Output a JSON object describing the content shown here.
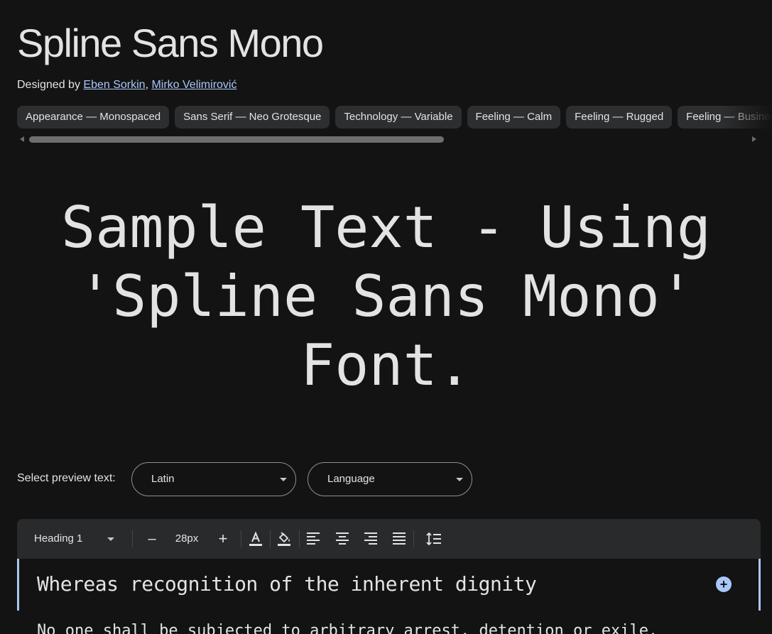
{
  "font": {
    "title": "Spline Sans Mono",
    "designed_by_prefix": "Designed by ",
    "designers": [
      "Eben Sorkin",
      "Mirko Velimirović"
    ],
    "designer_separator": ", "
  },
  "tags": [
    "Appearance — Monospaced",
    "Sans Serif — Neo Grotesque",
    "Technology — Variable",
    "Feeling — Calm",
    "Feeling — Rugged",
    "Feeling — Business"
  ],
  "sample_text": "Sample Text - Using 'Spline Sans Mono' Font.",
  "preview": {
    "label": "Select preview text:",
    "script_select": "Latin",
    "language_select": "Language"
  },
  "toolbar": {
    "style_select": "Heading 1",
    "decrease": "–",
    "size": "28px",
    "increase": "+"
  },
  "editor": {
    "heading_text": "Whereas recognition of the inherent dignity",
    "add_symbol": "+",
    "body_text": "No one shall be subjected to arbitrary arrest, detention or exile."
  },
  "colors": {
    "background": "#131313",
    "accent": "#a8c7fa",
    "chip": "#2d2e30",
    "toolbar": "#282a2c"
  }
}
